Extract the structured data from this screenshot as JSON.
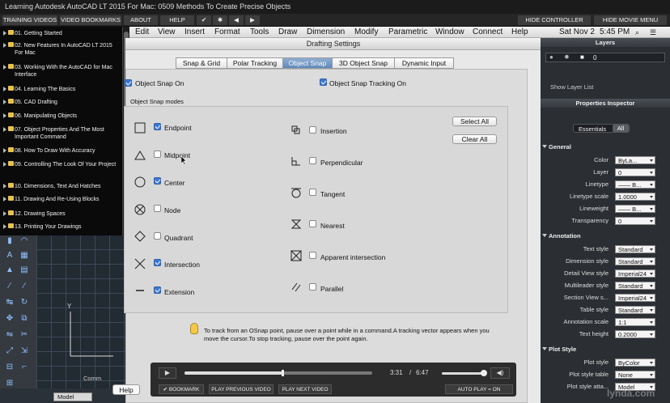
{
  "window": {
    "title": "Learning Autodesk AutoCAD LT 2015 For Mac: 0509 Methods To Create Precise Objects"
  },
  "player_bar": {
    "training_videos": "TRAINING VIDEOS",
    "bookmarks": "VIDEO BOOKMARKS",
    "about": "ABOUT",
    "help": "HELP",
    "check": "✔",
    "gear": "✱",
    "prev": "◀",
    "next": "▶",
    "hide_controller": "HIDE CONTROLLER",
    "hide_movie_menu": "HIDE MOVIE MENU"
  },
  "menubar": {
    "items": [
      "Edit",
      "View",
      "Insert",
      "Format",
      "Tools",
      "Draw",
      "Dimension",
      "Modify",
      "Parametric",
      "Window",
      "Connect",
      "Help"
    ],
    "date": "Sat Nov 2",
    "time": "5:45 PM"
  },
  "playlist": {
    "items": [
      "01. Getting Started",
      "02. New Features In AutoCAD LT 2015 For Mac",
      "03. Working With the AutoCAD for Mac Interface",
      "04. Learning The Basics",
      "05. CAD Drafting",
      "06. Manipulating Objects",
      "07. Object Properties And The Most Important Command",
      "08. How To Draw With Accuracy",
      "09. Controlling The Look Of Your Project",
      "10. Dimensions, Text And Hatches",
      "11. Drawing And Re-Using Blocks",
      "12. Drawing Spaces",
      "13. Printing Your Drawings"
    ]
  },
  "dialog": {
    "title": "Drafting Settings",
    "tabs": [
      "Snap & Grid",
      "Polar Tracking",
      "Object Snap",
      "3D Object Snap",
      "Dynamic Input"
    ],
    "active_tab": "Object Snap",
    "snap_on": "Object Snap On",
    "tracking_on": "Object Snap Tracking On",
    "modes_label": "Object Snap modes",
    "left_modes": [
      {
        "label": "Endpoint",
        "checked": true
      },
      {
        "label": "Midpoint",
        "checked": false
      },
      {
        "label": "Center",
        "checked": true
      },
      {
        "label": "Node",
        "checked": false
      },
      {
        "label": "Quadrant",
        "checked": false
      },
      {
        "label": "Intersection",
        "checked": true
      },
      {
        "label": "Extension",
        "checked": true
      }
    ],
    "right_modes": [
      {
        "label": "Insertion",
        "checked": false
      },
      {
        "label": "Perpendicular",
        "checked": false
      },
      {
        "label": "Tangent",
        "checked": false
      },
      {
        "label": "Nearest",
        "checked": false
      },
      {
        "label": "Apparent intersection",
        "checked": false
      },
      {
        "label": "Parallel",
        "checked": false
      }
    ],
    "select_all": "Select All",
    "clear_all": "Clear All",
    "tip": "To track from an OSnap point, pause over a point while in a command.A tracking vector appears when you move the cursor.To stop tracking, pause over the point again.",
    "help": "Help"
  },
  "video": {
    "current": "3:31",
    "slash": "/",
    "total": "6:47",
    "progress": 0.52,
    "bookmark": "✔ BOOKMARK",
    "prev": "PLAY PREVIOUS VIDEO",
    "next": "PLAY NEXT VIDEO",
    "autoplay": "AUTO PLAY = ON",
    "play": "▶",
    "mute": "◀)"
  },
  "right_panel": {
    "layers_title": "Layers",
    "layer_value": "0",
    "show_layer_list": "Show Layer List",
    "properties_title": "Properties Inspector",
    "essentials": "Essentials",
    "all": "All",
    "general": "General",
    "general_rows": [
      [
        "Color",
        "ByLa..."
      ],
      [
        "Layer",
        "0"
      ],
      [
        "Linetype",
        "—— B..."
      ],
      [
        "Linetype scale",
        "1.0000"
      ],
      [
        "Lineweight",
        "—— B..."
      ],
      [
        "Transparency",
        "0"
      ]
    ],
    "annotation": "Annotation",
    "annotation_rows": [
      [
        "Text style",
        "Standard"
      ],
      [
        "Dimension style",
        "Standard"
      ],
      [
        "Detail View style",
        "Imperial24"
      ],
      [
        "Multileader style",
        "Standard"
      ],
      [
        "Section View s...",
        "Imperial24"
      ],
      [
        "Table style",
        "Standard"
      ],
      [
        "Annotation scale",
        "1:1"
      ],
      [
        "Text height",
        "0.2000"
      ]
    ],
    "plot": "Plot Style",
    "plot_rows": [
      [
        "Plot style",
        "ByColor"
      ],
      [
        "Plot style table",
        "None"
      ],
      [
        "Plot style atta...",
        "Model"
      ]
    ]
  },
  "bottom": {
    "command": "Comm",
    "model": "Model",
    "watermark": "lynda.com"
  }
}
